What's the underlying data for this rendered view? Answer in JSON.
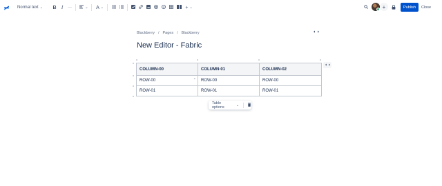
{
  "toolbar": {
    "text_style": "Normal text",
    "bold": "B",
    "italic": "I",
    "more": "···",
    "align_icon": "align-left-icon",
    "text_color_icon": "text-color-icon",
    "bullet_list_icon": "bullet-list-icon",
    "numbered_list_icon": "numbered-list-icon",
    "task_icon": "checkbox-icon",
    "link_icon": "link-icon",
    "image_icon": "image-icon",
    "mention_icon": "mention-icon",
    "emoji_icon": "emoji-icon",
    "table_icon": "table-icon",
    "layout_icon": "layout-icon",
    "insert_icon": "plus-icon"
  },
  "header_right": {
    "search_icon": "search-icon",
    "add_icon": "+",
    "restrictions_icon": "lock-icon",
    "publish_label": "Publish",
    "close_label": "Close"
  },
  "breadcrumb": {
    "items": [
      "Blackberry",
      "Pages",
      "Blackberry"
    ],
    "separator": "/"
  },
  "page": {
    "title": "New Editor - Fabric",
    "expand_icon": "expand-width-icon"
  },
  "table": {
    "headers": [
      "COLUMN-00",
      "COLUMN-01",
      "COLUMN-02"
    ],
    "rows": [
      [
        "ROW-00",
        "ROW-00",
        "ROW-00"
      ],
      [
        "ROW-01",
        "ROW-01",
        "ROW-01"
      ]
    ]
  },
  "table_toolbar": {
    "options_label": "Table options",
    "delete_icon": "trash-icon"
  },
  "colors": {
    "accent": "#0052cc",
    "text": "#172b4d",
    "header_bg": "#f4f5f7",
    "border": "#c1c7d0"
  }
}
